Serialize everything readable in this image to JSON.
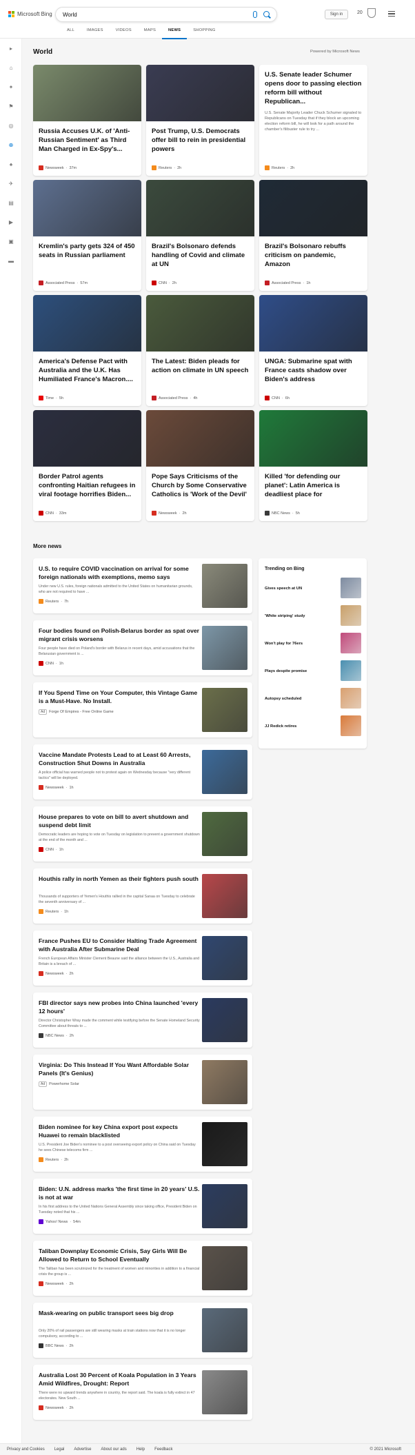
{
  "header": {
    "brand": "Microsoft Bing",
    "query": "World",
    "signin": "Sign in",
    "rewards": "20"
  },
  "tabs": [
    "ALL",
    "IMAGES",
    "VIDEOS",
    "MAPS",
    "NEWS",
    "SHOPPING"
  ],
  "section": {
    "title": "World",
    "powered": "Powered by Microsoft News"
  },
  "cards": [
    {
      "title": "Russia Accuses U.K. of 'Anti-Russian Sentiment' as Third Man Charged in Ex-Spy's...",
      "source": "Newsweek",
      "time": "37m",
      "logo": "#d62d20",
      "img": "#7a8a6b"
    },
    {
      "title": "Post Trump, U.S. Democrats offer bill to rein in presidential powers",
      "source": "Reuters",
      "time": "2h",
      "logo": "#f48b1c",
      "img": "#3a3c52"
    },
    {
      "title": "U.S. Senate leader Schumer opens door to passing election reform bill without Republican...",
      "snippet": "U.S. Senate Majority Leader Chuck Schumer signaled to Republicans on Tuesday that if they block an upcoming election reform bill, he will look for a path around the chamber's filibuster rule to try ...",
      "source": "Reuters",
      "time": "2h",
      "logo": "#f48b1c"
    },
    {
      "title": "Kremlin's party gets 324 of 450 seats in Russian parliament",
      "source": "Associated Press",
      "time": "57m",
      "logo": "#c41e24",
      "img": "#5d6f8f"
    },
    {
      "title": "Brazil's Bolsonaro defends handling of Covid and climate at UN",
      "source": "CNN",
      "time": "2h",
      "logo": "#cc0000",
      "img": "#3b4a3d"
    },
    {
      "title": "Brazil's Bolsonaro rebuffs criticism on pandemic, Amazon",
      "source": "Associated Press",
      "time": "1h",
      "logo": "#c41e24",
      "img": "#1f2a36"
    },
    {
      "title": "America's Defense Pact with Australia and the U.K. Has Humiliated France's Macron....",
      "source": "Time",
      "time": "5h",
      "logo": "#e90606",
      "img": "#2d4f7c"
    },
    {
      "title": "The Latest: Biden pleads for action on climate in UN speech",
      "source": "Associated Press",
      "time": "4h",
      "logo": "#c41e24",
      "img": "#4a5a3c"
    },
    {
      "title": "UNGA: Submarine spat with France casts shadow over Biden's address",
      "source": "CNN",
      "time": "6h",
      "logo": "#cc0000",
      "img": "#2f4d88"
    },
    {
      "title": "Border Patrol agents confronting Haitian refugees in viral footage horrifies Biden...",
      "source": "CNN",
      "time": "33m",
      "logo": "#cc0000",
      "img": "#2b2e3f"
    },
    {
      "title": "Pope Says Criticisms of the Church by Some Conservative Catholics is 'Work of the Devil'",
      "source": "Newsweek",
      "time": "2h",
      "logo": "#d62d20",
      "img": "#6b4a3a"
    },
    {
      "title": "Killed 'for defending our planet': Latin America is deadliest place for environmentalists",
      "source": "NBC News",
      "time": "5h",
      "logo": "#3a3a3a",
      "img": "#1f7a3a"
    }
  ],
  "more_title": "More news",
  "news": [
    {
      "title": "U.S. to require COVID vaccination on arrival for some foreign nationals with exemptions, memo says",
      "snippet": "Under new U.S. rules, foreign nationals admitted to the United States on humanitarian grounds, who are not required to have ...",
      "source": "Reuters",
      "time": "7h",
      "logo": "#f48b1c",
      "img": "#8a8a7a"
    },
    {
      "title": "Four bodies found on Polish-Belarus border as spat over migrant crisis worsens",
      "snippet": "Four people have died on Poland's border with Belarus in recent days, amid accusations that the Belarusian government is ...",
      "source": "CNN",
      "time": "1h",
      "logo": "#cc0000",
      "img": "#7d97a8"
    },
    {
      "title": "If You Spend Time on Your Computer, this Vintage Game is a Must-Have. No Install.",
      "snippet": "",
      "source": "Forge Of Empires - Free Online Game",
      "time": "",
      "ad": "Ad",
      "logo": "",
      "img": "#6b6f4a"
    },
    {
      "title": "Vaccine Mandate Protests Lead to at Least 60 Arrests, Construction Shut Downs in Australia",
      "snippet": "A police official has warned people not to protest again on Wednesday because \"very different tactics\" will be deployed.",
      "source": "Newsweek",
      "time": "1h",
      "logo": "#d62d20",
      "img": "#3c6a9a"
    },
    {
      "title": "House prepares to vote on bill to avert shutdown and suspend debt limit",
      "snippet": "Democratic leaders are hoping to vote on Tuesday on legislation to prevent a government shutdown at the end of the month and ...",
      "source": "CNN",
      "time": "1h",
      "logo": "#cc0000",
      "img": "#4f6a3f"
    },
    {
      "title": "Houthis rally in north Yemen as their fighters push south",
      "snippet": "Thousands of supporters of Yemen's Houthis rallied in the capital Sanaa on Tuesday to celebrate the seventh anniversary of ...",
      "source": "Reuters",
      "time": "1h",
      "logo": "#f48b1c",
      "img": "#b8474a"
    },
    {
      "title": "France Pushes EU to Consider Halting Trade Agreement with Australia After Submarine Deal",
      "snippet": "French European Affairs Minister Clement Beaune said the alliance between the U.S., Australia and Britain is a breach of ...",
      "source": "Newsweek",
      "time": "2h",
      "logo": "#d62d20",
      "img": "#2f4770"
    },
    {
      "title": "FBI director says new probes into China launched 'every 12 hours'",
      "snippet": "Director Christopher Wray made the comment while testifying before the Senate Homeland Security Committee about threats to ...",
      "source": "NBC News",
      "time": "2h",
      "logo": "#3a3a3a",
      "img": "#2a3a5f"
    },
    {
      "title": "Virginia: Do This Instead If You Want Affordable Solar Panels (It's Genius)",
      "snippet": "",
      "source": "Powerhome Solar",
      "time": "",
      "ad": "Ad",
      "logo": "",
      "img": "#8f7a62"
    },
    {
      "title": "Biden nominee for key China export post expects Huawei to remain blacklisted",
      "snippet": "U.S. President Joe Biden's nominee to a post overseeing export policy on China said on Tuesday he sees Chinese telecoms firm ...",
      "source": "Reuters",
      "time": "2h",
      "logo": "#f48b1c",
      "img": "#1a1a1a"
    },
    {
      "title": "Biden: U.N. address marks 'the first time in 20 years' U.S. is not at war",
      "snippet": "In his first address to the United Nations General Assembly since taking office, President Biden on Tuesday noted that his ...",
      "source": "Yahoo! News",
      "time": "54m",
      "logo": "#6001d2",
      "img": "#2b3c5f"
    },
    {
      "title": "Taliban Downplay Economic Crisis, Say Girls Will Be Allowed to Return to School Eventually",
      "snippet": "The Taliban has been scrutinized for the treatment of women and minorities in addition to a financial crisis the group is ...",
      "source": "Newsweek",
      "time": "2h",
      "logo": "#d62d20",
      "img": "#5a524a"
    },
    {
      "title": "Mask-wearing on public transport sees big drop",
      "snippet": "Only 20% of rail passengers are still wearing masks at train stations now that it is no longer compulsory, according to ...",
      "source": "BBC News",
      "time": "2h",
      "logo": "#333333",
      "img": "#5a6a7a"
    },
    {
      "title": "Australia Lost 30 Percent of Koala Population in 3 Years Amid Wildfires, Drought: Report",
      "snippet": "There were no upward trends anywhere in country, the report said. The koala is fully extinct in 47 electorates. New South ...",
      "source": "Newsweek",
      "time": "2h",
      "logo": "#d62d20",
      "img": "#8a8a8a"
    }
  ],
  "trending": {
    "title": "Trending on Bing",
    "items": [
      {
        "label": "Gives speech at UN",
        "img": "#7d8ba0"
      },
      {
        "label": "'White striping' study",
        "img": "#c9a06a"
      },
      {
        "label": "Won't play for 76ers",
        "img": "#c04a7a"
      },
      {
        "label": "Plays despite promise",
        "img": "#4a8fb0"
      },
      {
        "label": "Autopsy scheduled",
        "img": "#d9a070"
      },
      {
        "label": "JJ Redick retires",
        "img": "#d97a3a"
      }
    ]
  },
  "footer": {
    "links": [
      "Privacy and Cookies",
      "Legal",
      "Advertise",
      "About our ads",
      "Help",
      "Feedback"
    ],
    "copyright": "© 2021 Microsoft"
  }
}
